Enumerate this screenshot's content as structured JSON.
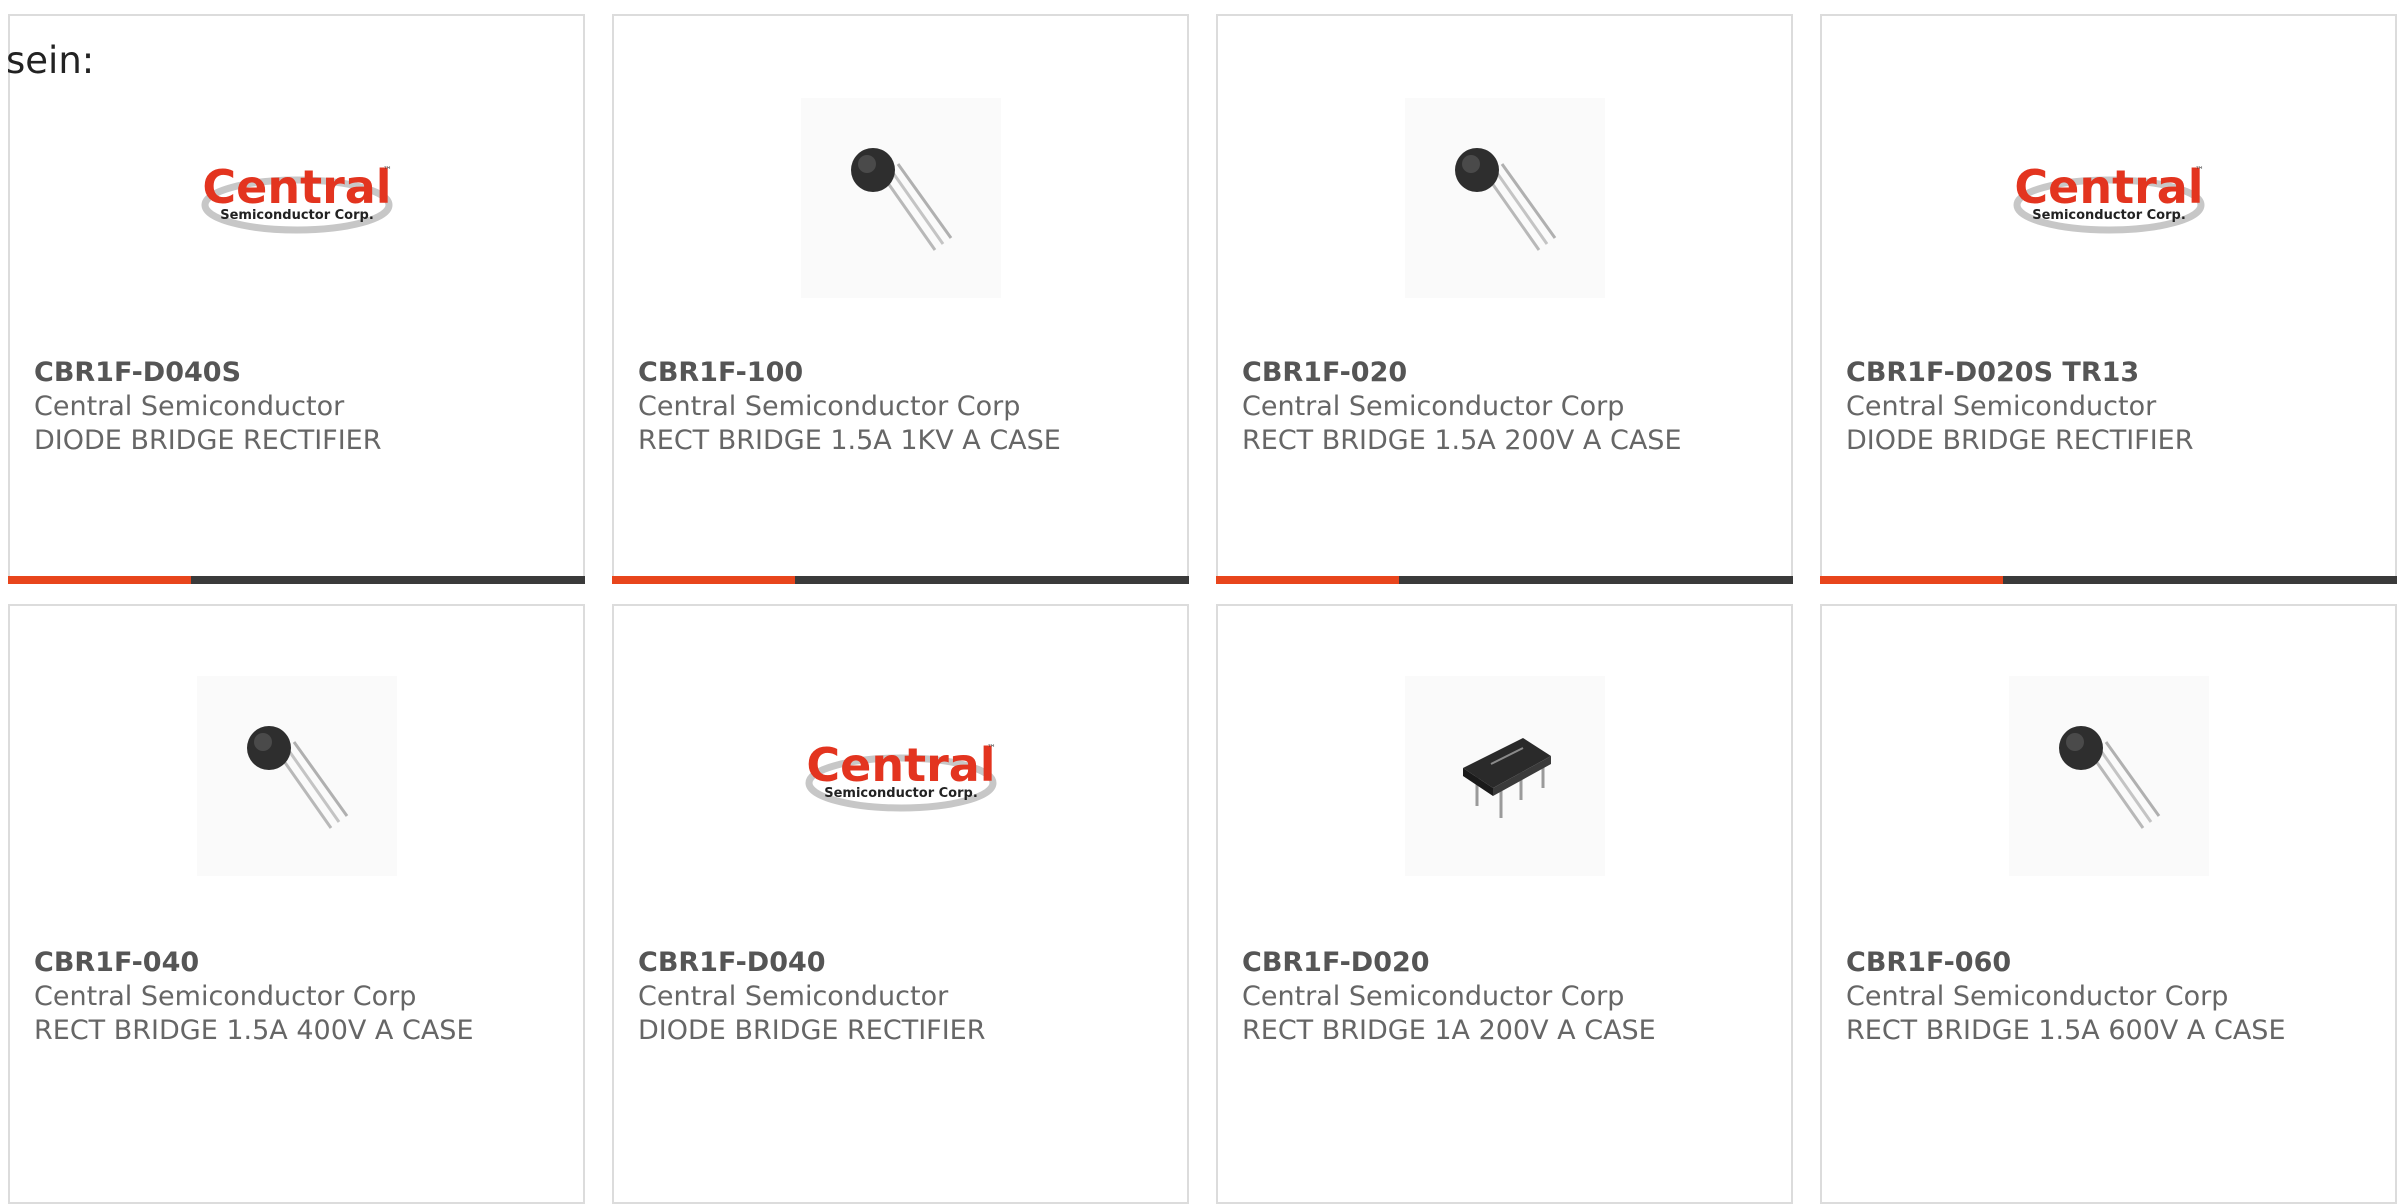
{
  "intro_text": "sein:",
  "colors": {
    "accent": "#e8451c",
    "bar": "#3a3a3a",
    "border": "#dcdcdc",
    "text": "#666666",
    "logo_red": "#e3341f"
  },
  "logo": {
    "wordmark": "Central",
    "subline": "Semiconductor Corp.",
    "trademark": "™"
  },
  "products": [
    {
      "part": "CBR1F-D040S",
      "maker": "Central Semiconductor",
      "description": "DIODE BRIDGE RECTIFIER",
      "image": "central-logo"
    },
    {
      "part": "CBR1F-100",
      "maker": "Central Semiconductor Corp",
      "description": "RECT BRIDGE 1.5A 1KV A CASE",
      "image": "to92-component"
    },
    {
      "part": "CBR1F-020",
      "maker": "Central Semiconductor Corp",
      "description": "RECT BRIDGE 1.5A 200V A CASE",
      "image": "to92-component"
    },
    {
      "part": "CBR1F-D020S TR13",
      "maker": "Central Semiconductor",
      "description": "DIODE BRIDGE RECTIFIER",
      "image": "central-logo"
    },
    {
      "part": "CBR1F-040",
      "maker": "Central Semiconductor Corp",
      "description": "RECT BRIDGE 1.5A 400V A CASE",
      "image": "to92-component"
    },
    {
      "part": "CBR1F-D040",
      "maker": "Central Semiconductor",
      "description": "DIODE BRIDGE RECTIFIER",
      "image": "central-logo"
    },
    {
      "part": "CBR1F-D020",
      "maker": "Central Semiconductor Corp",
      "description": "RECT BRIDGE 1A 200V A CASE",
      "image": "dip-component"
    },
    {
      "part": "CBR1F-060",
      "maker": "Central Semiconductor Corp",
      "description": "RECT BRIDGE 1.5A 600V A CASE",
      "image": "to92-component"
    }
  ]
}
